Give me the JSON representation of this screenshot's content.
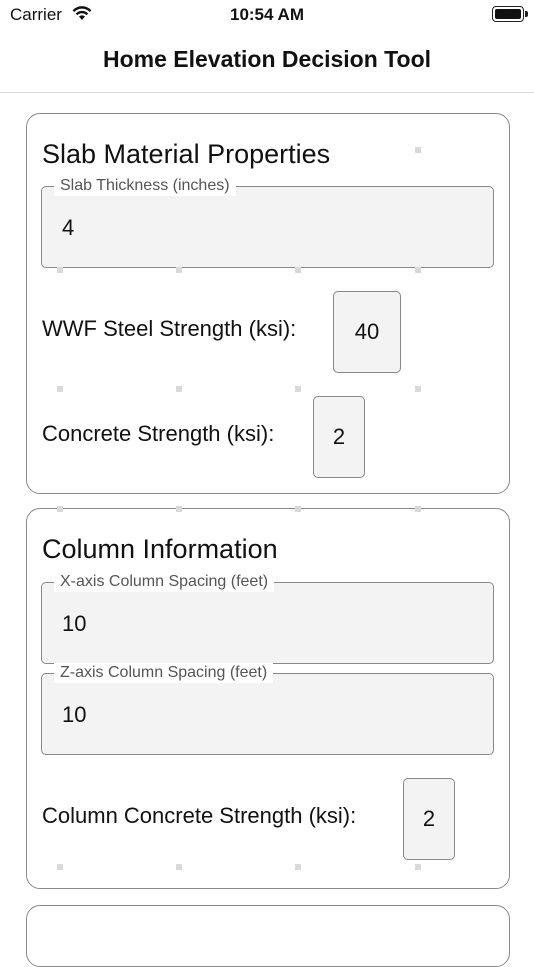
{
  "status_bar": {
    "carrier": "Carrier",
    "time": "10:54 AM"
  },
  "nav": {
    "title": "Home Elevation Decision Tool"
  },
  "slab_section": {
    "title": "Slab Material Properties",
    "slab_thickness": {
      "label": "Slab Thickness (inches)",
      "value": "4"
    },
    "wwf_steel_strength": {
      "label": "WWF Steel Strength (ksi):",
      "value": "40"
    },
    "concrete_strength": {
      "label": "Concrete Strength (ksi):",
      "value": "2"
    }
  },
  "column_section": {
    "title": "Column Information",
    "x_spacing": {
      "label": "X-axis Column Spacing (feet)",
      "value": "10"
    },
    "z_spacing": {
      "label": "Z-axis Column Spacing (feet)",
      "value": "10"
    },
    "column_concrete_strength": {
      "label": "Column Concrete Strength (ksi):",
      "value": "2"
    }
  }
}
